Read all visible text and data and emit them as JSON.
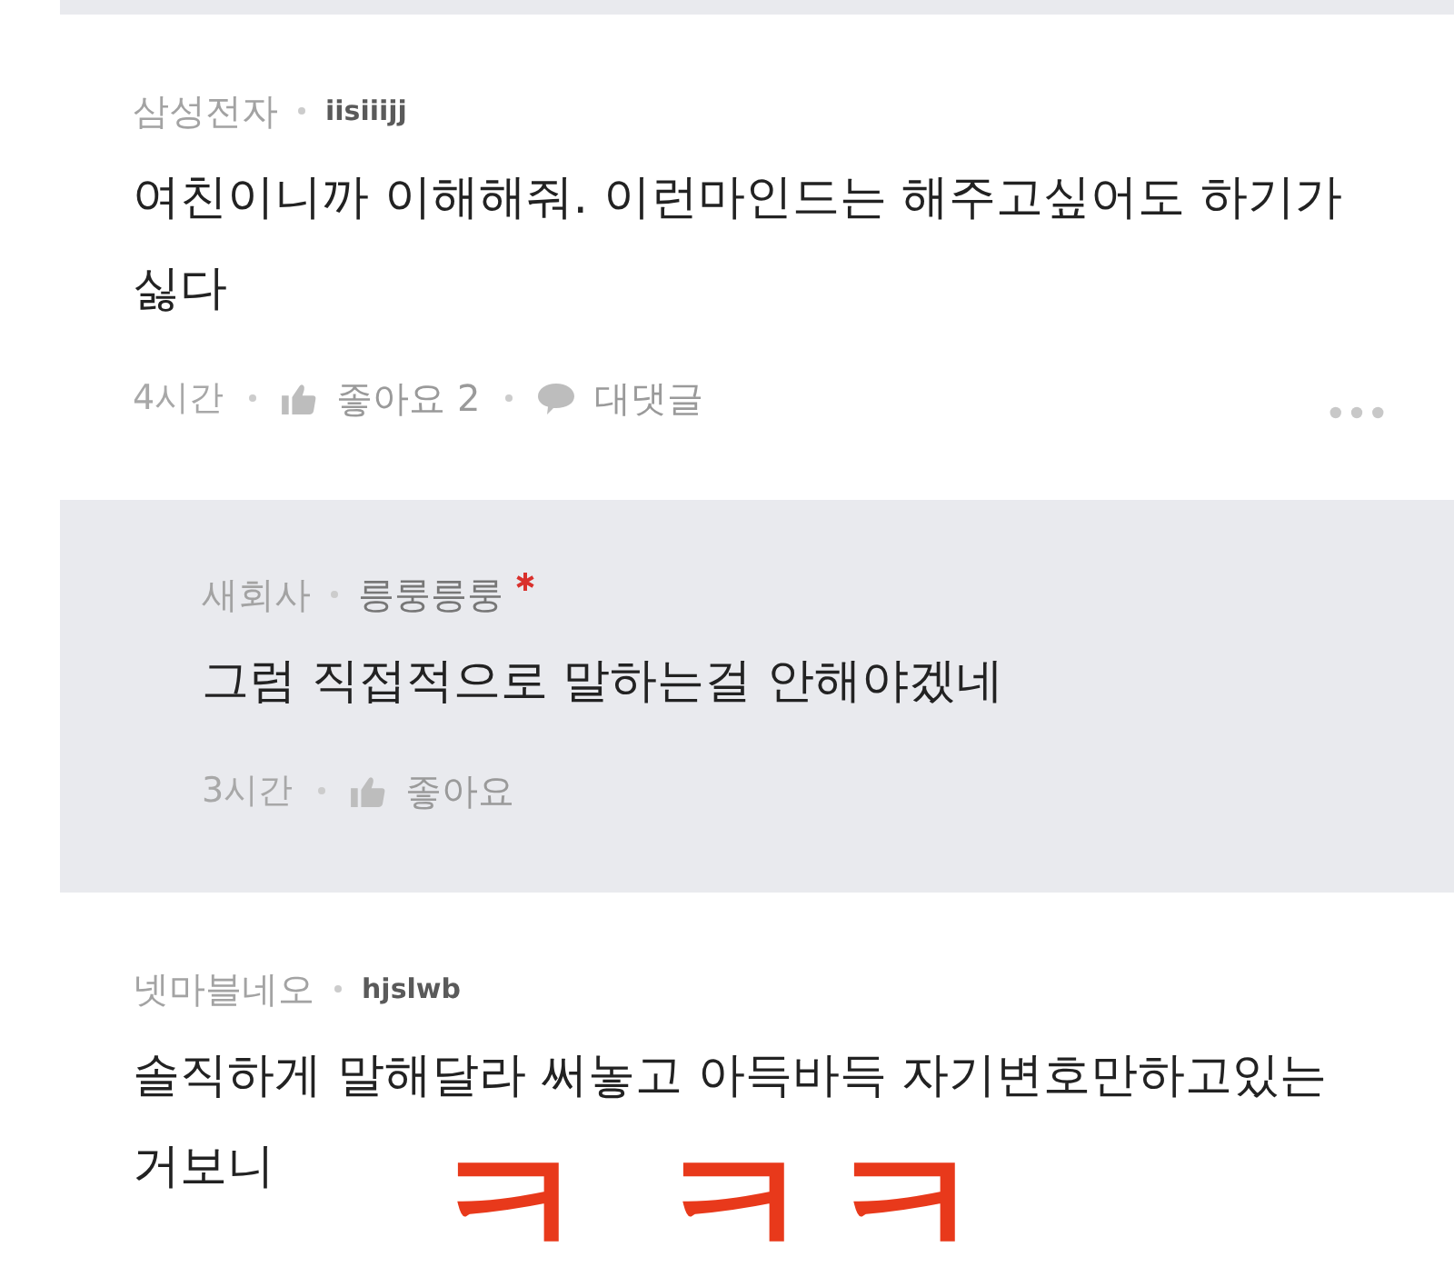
{
  "comments": [
    {
      "kind": "comment",
      "company": "삼성전자",
      "author": "iisiiijj",
      "is_writer": false,
      "text_lines": [
        "여친이니까 이해해줘. 이런마인드는 해주고싶어도 하기가",
        "싫다"
      ],
      "time": "4시간",
      "like": "좋아요 2",
      "reply": "대댓글",
      "more_menu": true
    },
    {
      "kind": "reply",
      "company": "새회사",
      "author": "릉룽릉룽",
      "is_writer": true,
      "text_lines": [
        "그럼 직접적으로 말하는걸 안해야겠네"
      ],
      "time": "3시간",
      "like": "좋아요",
      "more_menu": false
    },
    {
      "kind": "comment",
      "company": "넷마블네오",
      "author": "hjslwb",
      "is_writer": false,
      "text_lines": [
        "솔직하게 말해달라 써놓고 아득바득 자기변호만하고있는",
        "거보니"
      ],
      "more_menu": false
    }
  ],
  "handwritten_marks": [
    "ㅋ",
    "ㅋ",
    "ㅋ"
  ]
}
